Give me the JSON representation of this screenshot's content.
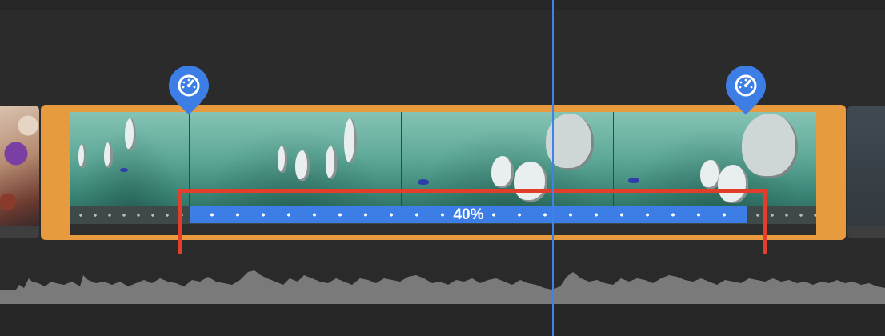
{
  "timeline": {
    "speed_range": {
      "label": "40%",
      "color": "#3d7ee6",
      "start_marker_icon": "speedometer-icon",
      "end_marker_icon": "speedometer-icon"
    },
    "selected_clip": {
      "border_color": "#e79a3e"
    },
    "highlight_color": "#e23e2b",
    "playhead_color": "#3f83e8"
  }
}
